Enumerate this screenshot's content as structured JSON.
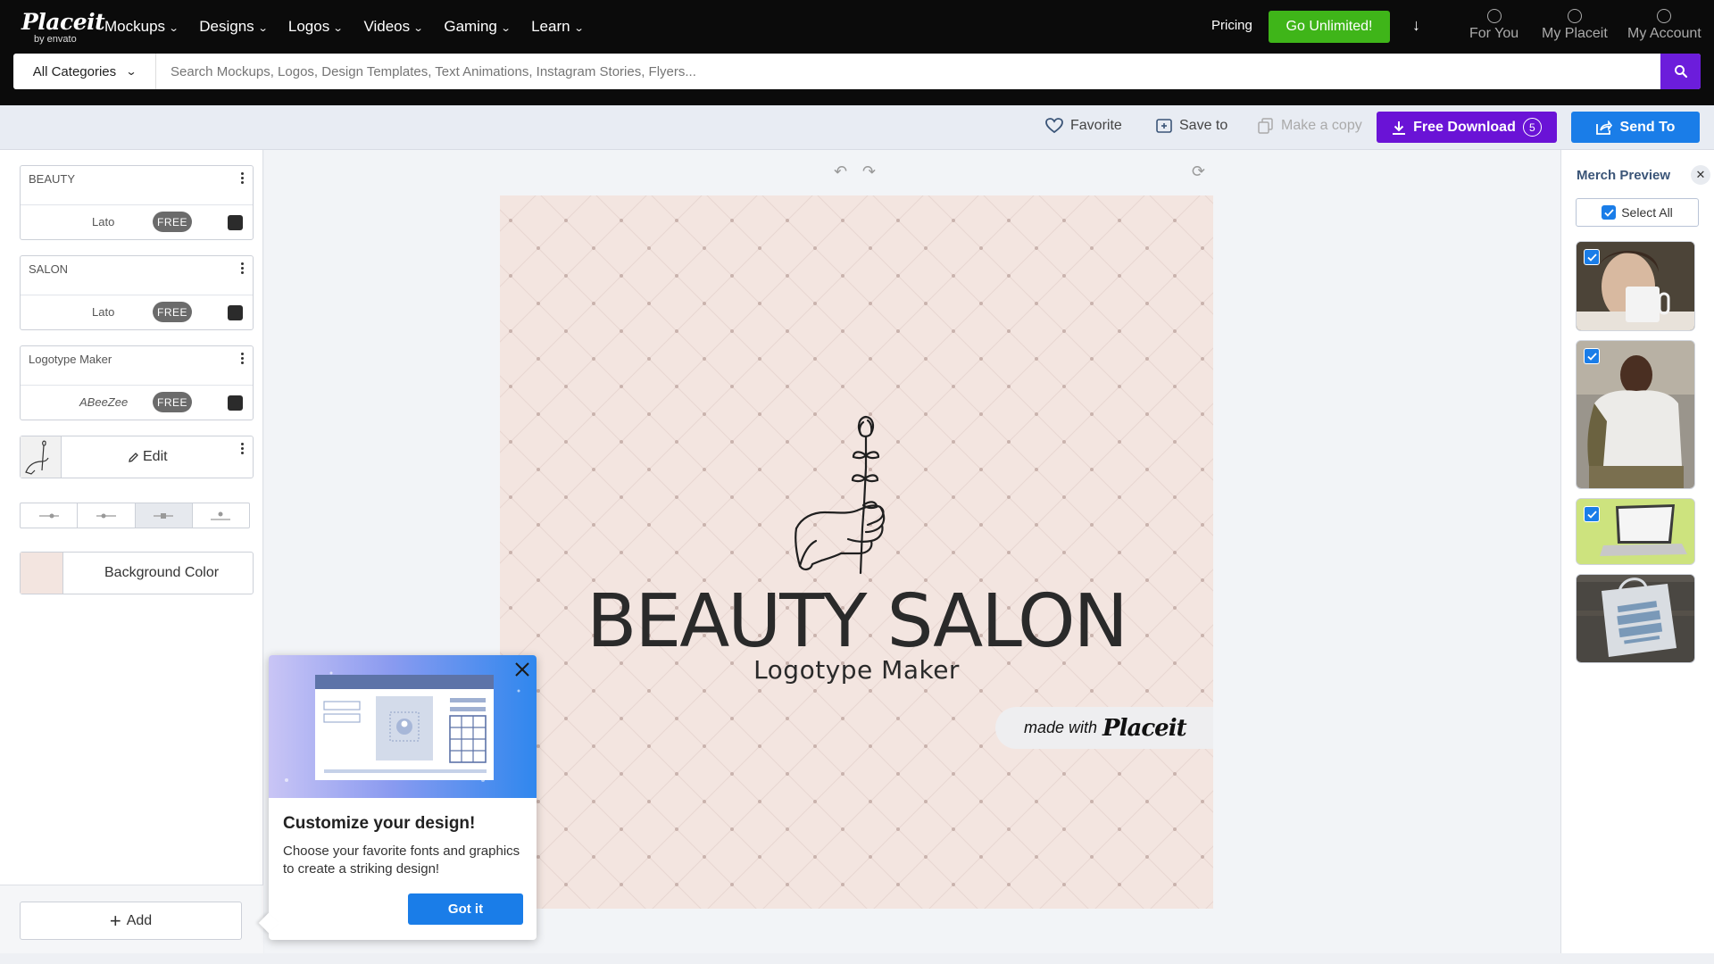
{
  "brand": {
    "name": "Placeit",
    "sub": "by envato"
  },
  "nav": {
    "menu": [
      {
        "label": "Mockups"
      },
      {
        "label": "Designs"
      },
      {
        "label": "Logos"
      },
      {
        "label": "Videos"
      },
      {
        "label": "Gaming"
      },
      {
        "label": "Learn"
      }
    ],
    "pricing": "Pricing",
    "cta": "Go Unlimited!",
    "user_links": [
      {
        "label": "For You",
        "icon": "compass-icon"
      },
      {
        "label": "My Placeit",
        "icon": "smiley-icon"
      },
      {
        "label": "My Account",
        "icon": "account-icon"
      }
    ]
  },
  "search": {
    "category": "All Categories",
    "placeholder": "Search Mockups, Logos, Design Templates, Text Animations, Instagram Stories, Flyers..."
  },
  "toolbar": {
    "favorite": "Favorite",
    "save_to": "Save to",
    "make_copy": "Make a copy",
    "free_download": "Free Download",
    "download_count": "5",
    "send_to": "Send To"
  },
  "layers": [
    {
      "text": "BEAUTY",
      "font": "Lato",
      "badge": "FREE",
      "color": "#2b2b2b"
    },
    {
      "text": "SALON",
      "font": "Lato",
      "badge": "FREE",
      "color": "#2b2b2b"
    },
    {
      "text": "Logotype Maker",
      "font": "ABeeZee",
      "badge": "FREE",
      "color": "#2b2b2b"
    }
  ],
  "graphic_layer": {
    "edit_label": "Edit"
  },
  "background": {
    "label": "Background Color",
    "color": "#f3e5e0"
  },
  "add": {
    "label": "Add"
  },
  "design": {
    "title": "BEAUTY SALON",
    "subtitle": "Logotype Maker",
    "watermark_made": "made with",
    "watermark_brand": "Placeit"
  },
  "popup": {
    "title": "Customize your design!",
    "description": "Choose your favorite fonts and graphics to create a striking design!",
    "button": "Got it"
  },
  "merch": {
    "title": "Merch Preview",
    "select_all": "Select All"
  },
  "colors": {
    "accent_purple": "#6a13d6",
    "accent_blue": "#1a7de8",
    "accent_green": "#3fb519"
  }
}
